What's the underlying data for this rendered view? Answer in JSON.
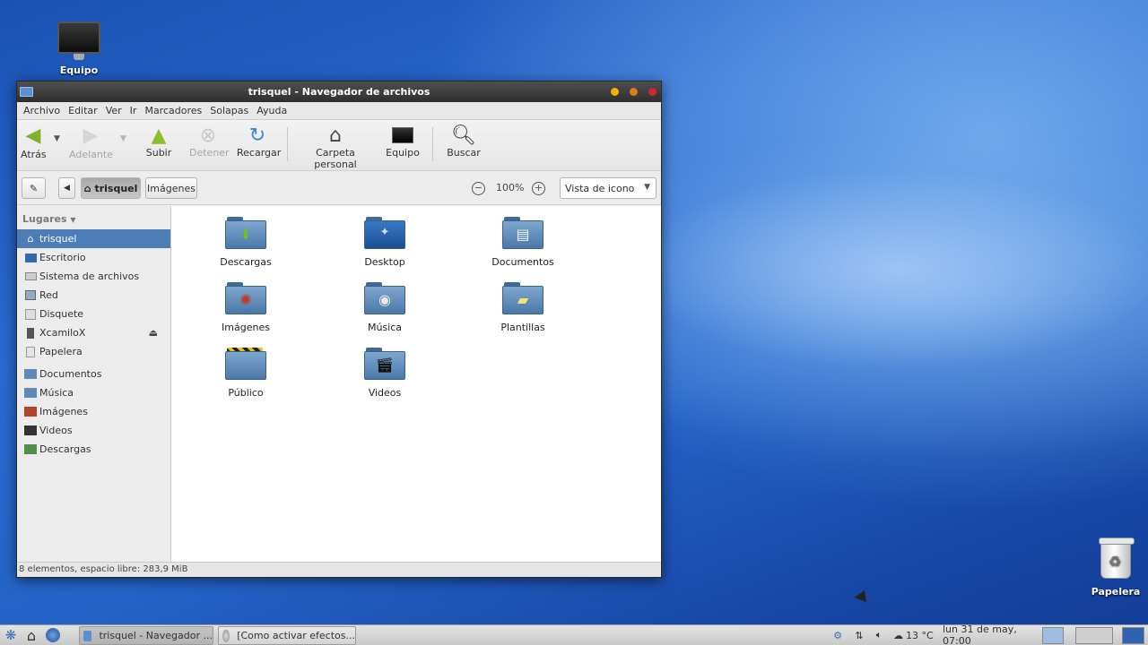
{
  "desktop": {
    "icons": [
      {
        "label": "Equipo"
      },
      {
        "label": "Papelera"
      }
    ]
  },
  "window": {
    "title": "trisquel - Navegador de archivos",
    "menu": [
      "Archivo",
      "Editar",
      "Ver",
      "Ir",
      "Marcadores",
      "Solapas",
      "Ayuda"
    ],
    "toolbar": {
      "back": "Atrás",
      "forward": "Adelante",
      "up": "Subir",
      "stop": "Detener",
      "reload": "Recargar",
      "home": "Carpeta personal",
      "computer": "Equipo",
      "search": "Buscar"
    },
    "location": {
      "path": [
        "trisquel",
        "Imágenes"
      ],
      "zoom": "100%",
      "view_mode": "Vista de icono"
    },
    "sidebar": {
      "heading": "Lugares",
      "places": [
        {
          "label": "trisquel",
          "icon": "home-icon",
          "selected": true
        },
        {
          "label": "Escritorio",
          "icon": "desktop-icon"
        },
        {
          "label": "Sistema de archivos",
          "icon": "drive-icon"
        },
        {
          "label": "Red",
          "icon": "network-icon"
        },
        {
          "label": "Disquete",
          "icon": "floppy-icon"
        },
        {
          "label": "XcamiloX",
          "icon": "usb-drive-icon",
          "ejectable": true
        },
        {
          "label": "Papelera",
          "icon": "trash-icon"
        }
      ],
      "bookmarks": [
        {
          "label": "Documentos",
          "icon": "folder-documents-icon"
        },
        {
          "label": "Música",
          "icon": "folder-music-icon"
        },
        {
          "label": "Imágenes",
          "icon": "folder-pictures-icon"
        },
        {
          "label": "Videos",
          "icon": "folder-videos-icon"
        },
        {
          "label": "Descargas",
          "icon": "folder-downloads-icon"
        }
      ]
    },
    "files": [
      {
        "label": "Descargas",
        "icon": "folder-downloads-icon"
      },
      {
        "label": "Desktop",
        "icon": "folder-desktop-icon"
      },
      {
        "label": "Documentos",
        "icon": "folder-documents-icon"
      },
      {
        "label": "Imágenes",
        "icon": "folder-pictures-icon"
      },
      {
        "label": "Música",
        "icon": "folder-music-icon"
      },
      {
        "label": "Plantillas",
        "icon": "folder-templates-icon"
      },
      {
        "label": "Público",
        "icon": "folder-public-icon"
      },
      {
        "label": "Videos",
        "icon": "folder-videos-icon"
      }
    ],
    "status": "8 elementos, espacio libre: 283,9 MiB"
  },
  "taskbar": {
    "tasks": [
      {
        "label": "trisquel - Navegador ...",
        "active": true
      },
      {
        "label": "[Como activar efectos...",
        "active": false
      }
    ],
    "temperature": "13 °C",
    "clock": "lun 31 de may, 07:00"
  },
  "colors": {
    "selection": "#4c7db6",
    "titlebar": "#3a3a3a",
    "close": "#d2262b",
    "minimize": "#f0b400",
    "maximize": "#e07a1f"
  }
}
